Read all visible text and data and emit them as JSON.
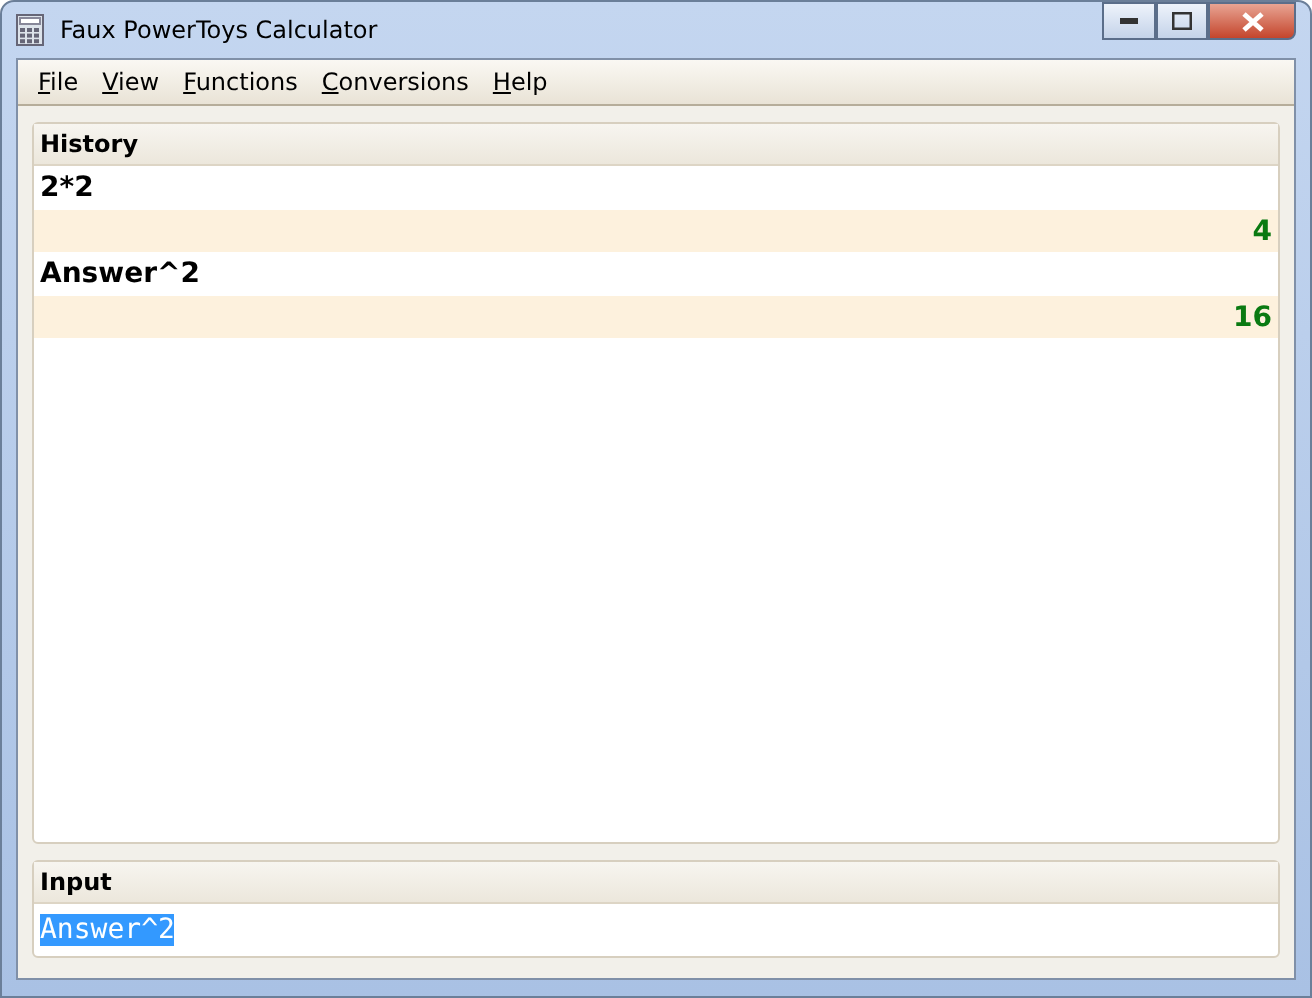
{
  "window": {
    "title": "Faux PowerToys Calculator"
  },
  "menu": [
    "File",
    "View",
    "Functions",
    "Conversions",
    "Help"
  ],
  "history": {
    "title": "History",
    "entries": [
      {
        "expression": "2*2",
        "result": "4"
      },
      {
        "expression": "Answer^2",
        "result": "16"
      }
    ]
  },
  "input": {
    "title": "Input",
    "value": "Answer^2",
    "selected": true
  }
}
